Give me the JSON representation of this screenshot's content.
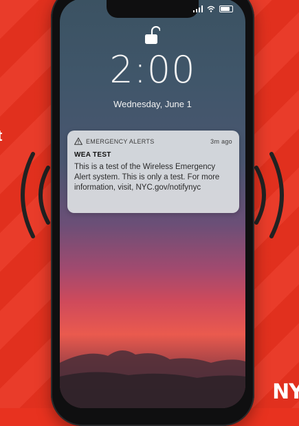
{
  "background": {
    "accent_color": "#e8321f",
    "left_partial_text": "t",
    "logo_text": "NY"
  },
  "phone": {
    "status_bar": {
      "signal": "signal-icon",
      "wifi": "wifi-icon",
      "battery": "battery-icon"
    },
    "lock_icon": "unlocked-padlock-icon",
    "time": "2:00",
    "date": "Wednesday, June 1",
    "notification": {
      "app_icon": "warning-triangle-icon",
      "app_name": "EMERGENCY ALERTS",
      "timestamp": "3m ago",
      "title": "WEA TEST",
      "body": "This is a test of the Wireless Emergency Alert system. This is only a test. For more information, visit, NYC.gov/notifynyc"
    }
  }
}
